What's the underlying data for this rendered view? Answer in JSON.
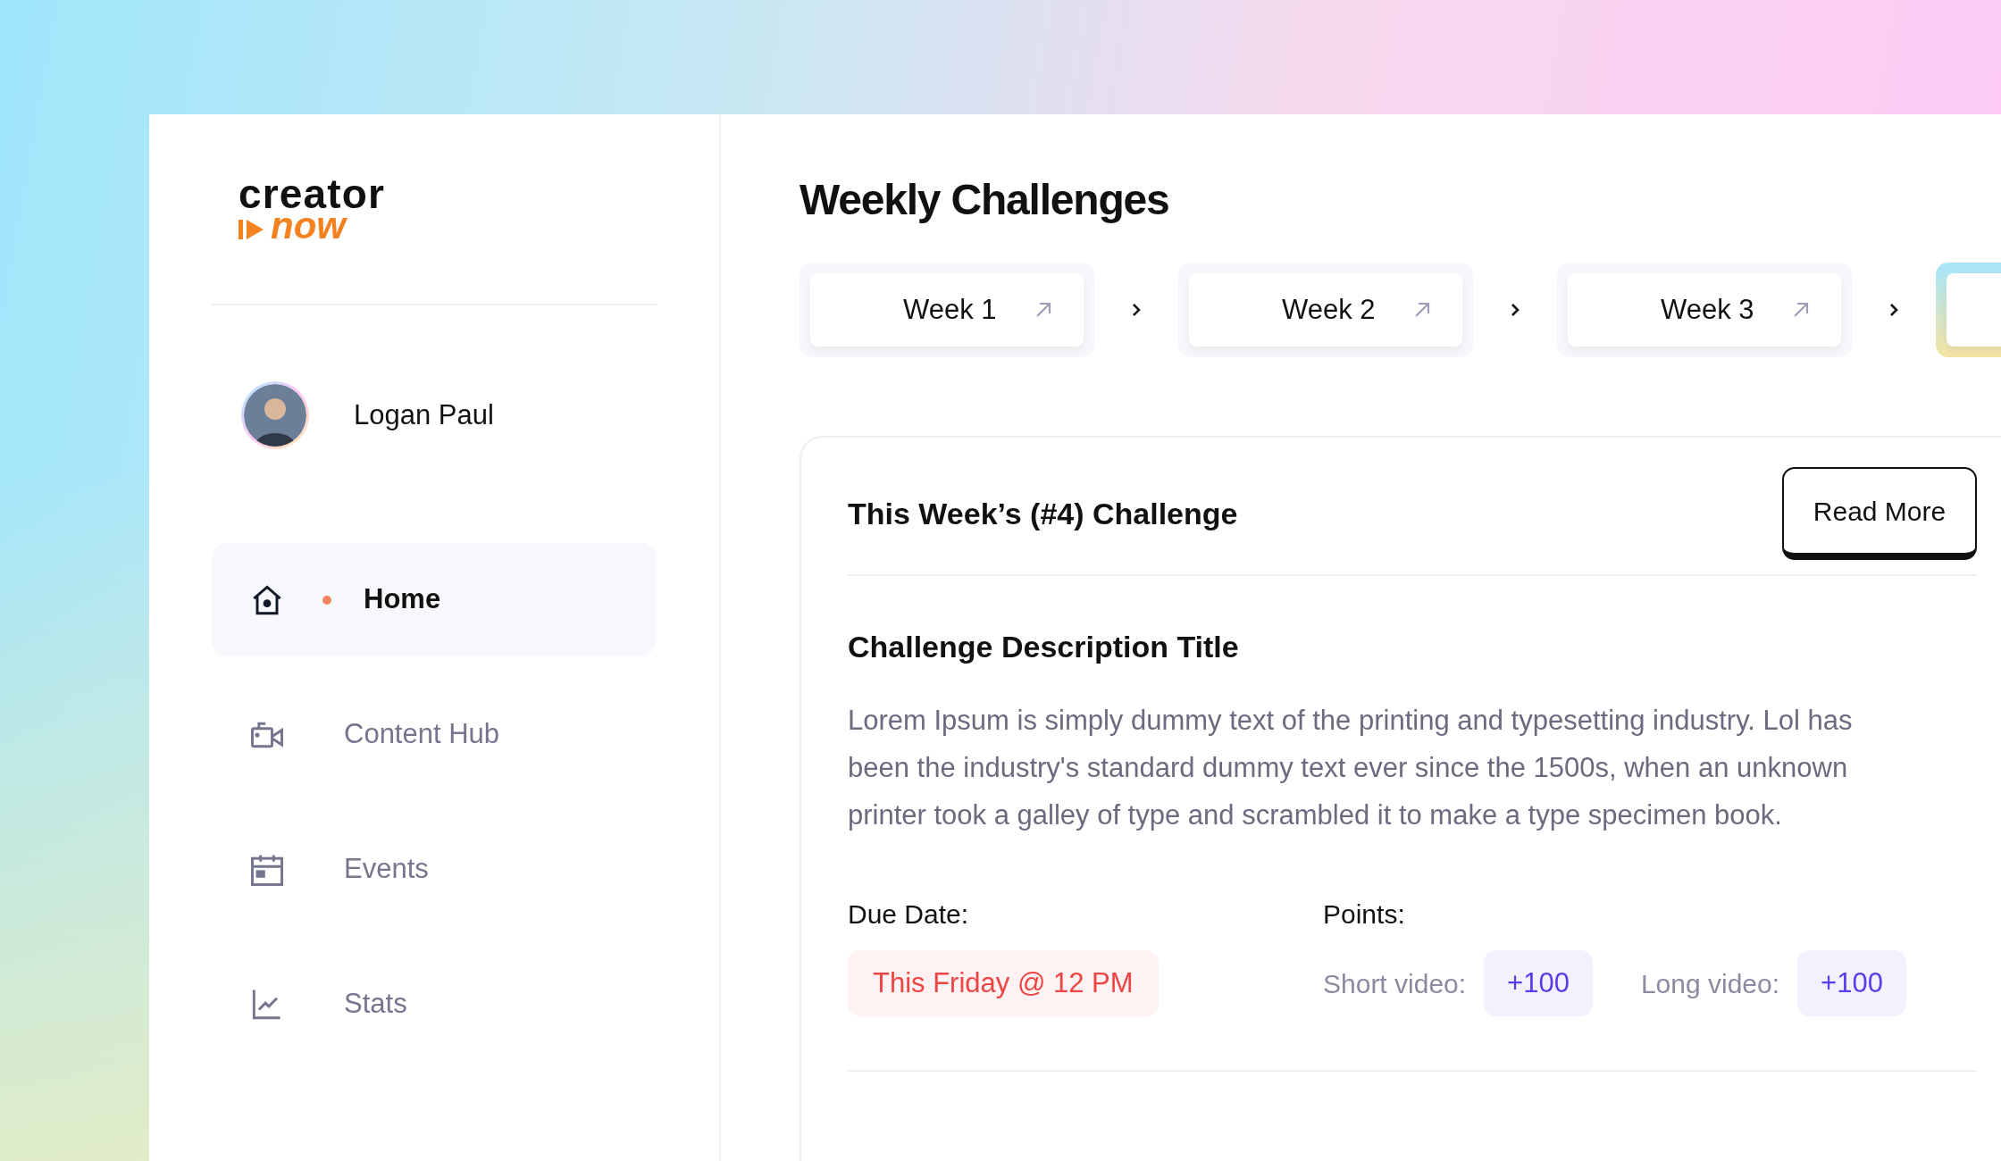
{
  "logo": {
    "top": "creator",
    "bottom": "now"
  },
  "user": {
    "name": "Logan Paul"
  },
  "nav": [
    {
      "label": "Home",
      "selected": true
    },
    {
      "label": "Content Hub",
      "selected": false
    },
    {
      "label": "Events",
      "selected": false
    },
    {
      "label": "Stats",
      "selected": false
    }
  ],
  "title": "Weekly Challenges",
  "weeks": [
    {
      "label": "Week 1",
      "selected": false
    },
    {
      "label": "Week 2",
      "selected": false
    },
    {
      "label": "Week 3",
      "selected": false
    },
    {
      "selected": true
    }
  ],
  "challenge": {
    "heading": "This Week’s (#4) Challenge",
    "button": "Read More",
    "desc_title": "Challenge Description Title",
    "description": "Lorem Ipsum is simply dummy text of the printing and typesetting industry. Lol has been the industry's standard dummy text ever since the 1500s, when an unknown printer took a galley of type and scrambled it to make a type specimen book.",
    "due_label": "Due Date:",
    "due": "This Friday @ 12 PM",
    "points_label": "Points:",
    "points": [
      {
        "label": "Short video:",
        "value": "+100"
      },
      {
        "label": "Long video:",
        "value": "+100"
      }
    ]
  }
}
